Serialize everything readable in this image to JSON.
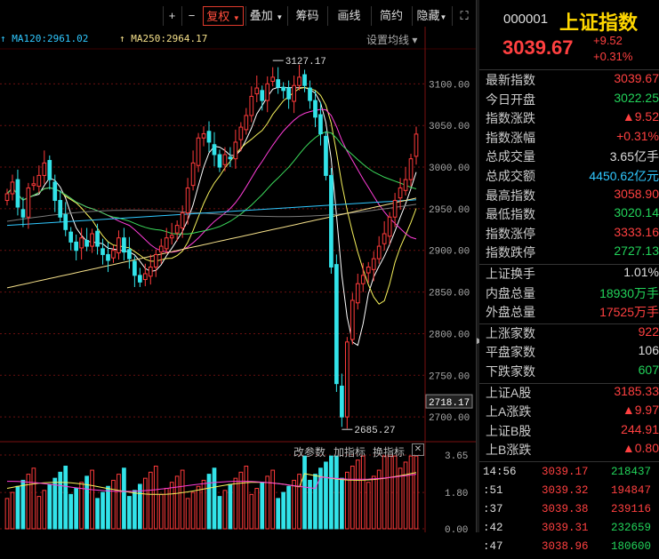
{
  "toolbar": {
    "buttons": [
      "+",
      "−",
      "复权",
      "叠加",
      "筹码",
      "画线",
      "简约",
      "隐藏"
    ],
    "active": "复权"
  },
  "ma_legend": [
    {
      "label": "MA120:2961.02",
      "color": "#30c8ff"
    },
    {
      "label": "MA250:2964.17",
      "color": "#f5e08a"
    }
  ],
  "set_ma_label": "设置均线 ▾",
  "indicator_bar": {
    "a": "改参数",
    "b": "加指标",
    "c": "换指标"
  },
  "chart_data": {
    "type": "candlestick",
    "price_axis": {
      "ticks": [
        3100.0,
        3050.0,
        3000.0,
        2950.0,
        2900.0,
        2850.0,
        2800.0,
        2750.0,
        2700.0
      ],
      "range": [
        2682,
        3142
      ]
    },
    "current_price_label": "2718.17",
    "high_label": "3127.17",
    "low_label": "2685.27",
    "volume_axis": {
      "ticks": [
        "3.65",
        "1.80",
        "0.00"
      ],
      "range": [
        0,
        3.65
      ]
    },
    "closes": [
      2968,
      2982,
      2952,
      2940,
      2975,
      2980,
      2990,
      3005,
      2985,
      2960,
      2940,
      2925,
      2910,
      2900,
      2915,
      2905,
      2920,
      2905,
      2895,
      2888,
      2900,
      2915,
      2898,
      2890,
      2870,
      2862,
      2872,
      2880,
      2895,
      2905,
      2915,
      2918,
      2930,
      2945,
      2975,
      3005,
      3035,
      3040,
      3030,
      3015,
      3000,
      3015,
      3010,
      3030,
      3048,
      3062,
      3085,
      3095,
      3080,
      3100,
      3108,
      3096,
      3092,
      3082,
      3098,
      3108,
      3098,
      3080,
      3060,
      3040,
      2990,
      2880,
      2740,
      2700,
      2790,
      2840,
      2860,
      2870,
      2880,
      2890,
      2905,
      2920,
      2940,
      2960,
      2975,
      2985,
      3010,
      3039.67
    ],
    "ma_series": [
      {
        "name": "MA5",
        "color": "#ffffff"
      },
      {
        "name": "MA10",
        "color": "#f7f25c"
      },
      {
        "name": "MA20",
        "color": "#ff3dd8"
      },
      {
        "name": "MA30",
        "color": "#3cdc5c"
      },
      {
        "name": "MA60",
        "color": "#7a7a7a"
      },
      {
        "name": "MA120",
        "color": "#30c8ff"
      },
      {
        "name": "MA250",
        "color": "#f5e08a"
      }
    ]
  },
  "quote": {
    "code": "000001",
    "name": "上证指数",
    "price": "3039.67",
    "change": "+9.52",
    "change_pct": "+0.31%",
    "rows_a": [
      {
        "label": "最新指数",
        "value": "3039.67",
        "color": "red"
      },
      {
        "label": "今日开盘",
        "value": "3022.25",
        "color": "green"
      },
      {
        "label": "指数涨跌",
        "value": "▲9.52",
        "color": "red"
      },
      {
        "label": "指数涨幅",
        "value": "+0.31%",
        "color": "red"
      },
      {
        "label": "总成交量",
        "value": "3.65亿手",
        "color": "white"
      },
      {
        "label": "总成交额",
        "value": "4450.62亿元",
        "color": "cyan"
      },
      {
        "label": "最高指数",
        "value": "3058.90",
        "color": "red"
      },
      {
        "label": "最低指数",
        "value": "3020.14",
        "color": "green"
      },
      {
        "label": "指数涨停",
        "value": "3333.16",
        "color": "red"
      },
      {
        "label": "指数跌停",
        "value": "2727.13",
        "color": "green"
      }
    ],
    "rows_b": [
      {
        "label": "上证换手",
        "value": "1.01%",
        "color": "white"
      },
      {
        "label": "内盘总量",
        "value": "18930万手",
        "color": "green"
      },
      {
        "label": "外盘总量",
        "value": "17525万手",
        "color": "red"
      }
    ],
    "rows_c": [
      {
        "label": "上涨家数",
        "value": "922",
        "color": "red"
      },
      {
        "label": "平盘家数",
        "value": "106",
        "color": "white"
      },
      {
        "label": "下跌家数",
        "value": "607",
        "color": "green"
      }
    ],
    "rows_d": [
      {
        "label": "上证A股",
        "value": "3185.33",
        "color": "red"
      },
      {
        "label": "上A涨跌",
        "value": "▲9.97",
        "color": "red"
      },
      {
        "label": "上证B股",
        "value": "244.91",
        "color": "red"
      },
      {
        "label": "上B涨跌",
        "value": "▲0.80",
        "color": "red"
      }
    ],
    "ticks": [
      {
        "time": "14:56",
        "price": "3039.17",
        "vol": "218437",
        "vcolor": "green"
      },
      {
        "time": ":51",
        "price": "3039.32",
        "vol": "194847",
        "vcolor": "red"
      },
      {
        "time": ":37",
        "price": "3039.38",
        "vol": "239116",
        "vcolor": "red"
      },
      {
        "time": ":42",
        "price": "3039.31",
        "vol": "232659",
        "vcolor": "green"
      },
      {
        "time": ":47",
        "price": "3038.96",
        "vol": "180600",
        "vcolor": "green"
      }
    ]
  }
}
